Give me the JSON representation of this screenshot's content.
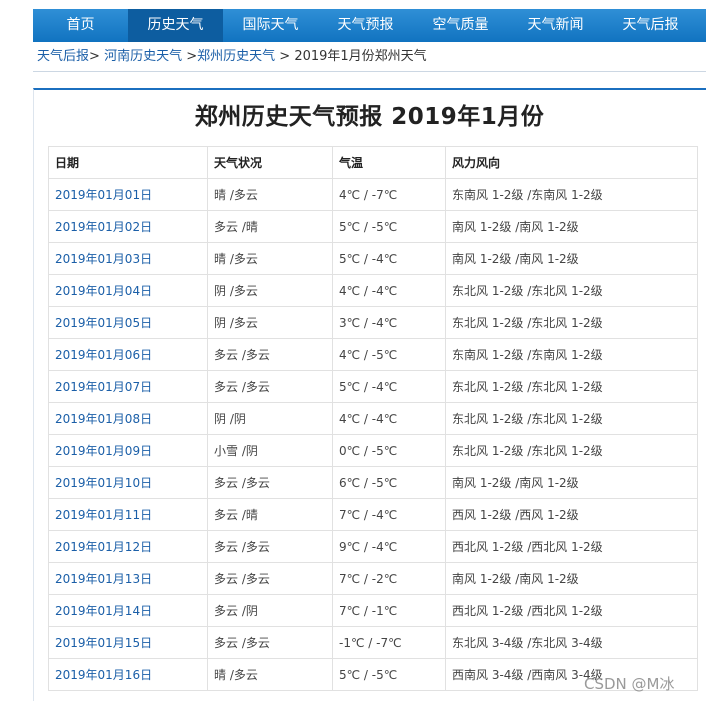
{
  "nav": {
    "items": [
      {
        "label": "首页",
        "active": false
      },
      {
        "label": "历史天气",
        "active": true
      },
      {
        "label": "国际天气",
        "active": false
      },
      {
        "label": "天气预报",
        "active": false
      },
      {
        "label": "空气质量",
        "active": false
      },
      {
        "label": "天气新闻",
        "active": false
      },
      {
        "label": "天气后报",
        "active": false
      }
    ]
  },
  "breadcrumb": {
    "link1": "天气后报",
    "sep1": ">",
    "link2": "河南历史天气",
    "sep2": ">",
    "link3": "郑州历史天气",
    "sep3": ">",
    "current": "2019年1月份郑州天气"
  },
  "page_title": "郑州历史天气预报 2019年1月份",
  "table": {
    "headers": [
      "日期",
      "天气状况",
      "气温",
      "风力风向"
    ],
    "rows": [
      [
        "2019年01月01日",
        "晴 /多云",
        "4℃ / -7℃",
        "东南风 1-2级 /东南风 1-2级"
      ],
      [
        "2019年01月02日",
        "多云 /晴",
        "5℃ / -5℃",
        "南风 1-2级 /南风 1-2级"
      ],
      [
        "2019年01月03日",
        "晴 /多云",
        "5℃ / -4℃",
        "南风 1-2级 /南风 1-2级"
      ],
      [
        "2019年01月04日",
        "阴 /多云",
        "4℃ / -4℃",
        "东北风 1-2级 /东北风 1-2级"
      ],
      [
        "2019年01月05日",
        "阴 /多云",
        "3℃ / -4℃",
        "东北风 1-2级 /东北风 1-2级"
      ],
      [
        "2019年01月06日",
        "多云 /多云",
        "4℃ / -5℃",
        "东南风 1-2级 /东南风 1-2级"
      ],
      [
        "2019年01月07日",
        "多云 /多云",
        "5℃ / -4℃",
        "东北风 1-2级 /东北风 1-2级"
      ],
      [
        "2019年01月08日",
        "阴 /阴",
        "4℃ / -4℃",
        "东北风 1-2级 /东北风 1-2级"
      ],
      [
        "2019年01月09日",
        "小雪 /阴",
        "0℃ / -5℃",
        "东北风 1-2级 /东北风 1-2级"
      ],
      [
        "2019年01月10日",
        "多云 /多云",
        "6℃ / -5℃",
        "南风 1-2级 /南风 1-2级"
      ],
      [
        "2019年01月11日",
        "多云 /晴",
        "7℃ / -4℃",
        "西风 1-2级 /西风 1-2级"
      ],
      [
        "2019年01月12日",
        "多云 /多云",
        "9℃ / -4℃",
        "西北风 1-2级 /西北风 1-2级"
      ],
      [
        "2019年01月13日",
        "多云 /多云",
        "7℃ / -2℃",
        "南风 1-2级 /南风 1-2级"
      ],
      [
        "2019年01月14日",
        "多云 /阴",
        "7℃ / -1℃",
        "西北风 1-2级 /西北风 1-2级"
      ],
      [
        "2019年01月15日",
        "多云 /多云",
        "-1℃ / -7℃",
        "东北风 3-4级 /东北风 3-4级"
      ],
      [
        "2019年01月16日",
        "晴 /多云",
        "5℃ / -5℃",
        "西南风 3-4级 /西南风 3-4级"
      ]
    ]
  },
  "watermark": "CSDN @M冰"
}
